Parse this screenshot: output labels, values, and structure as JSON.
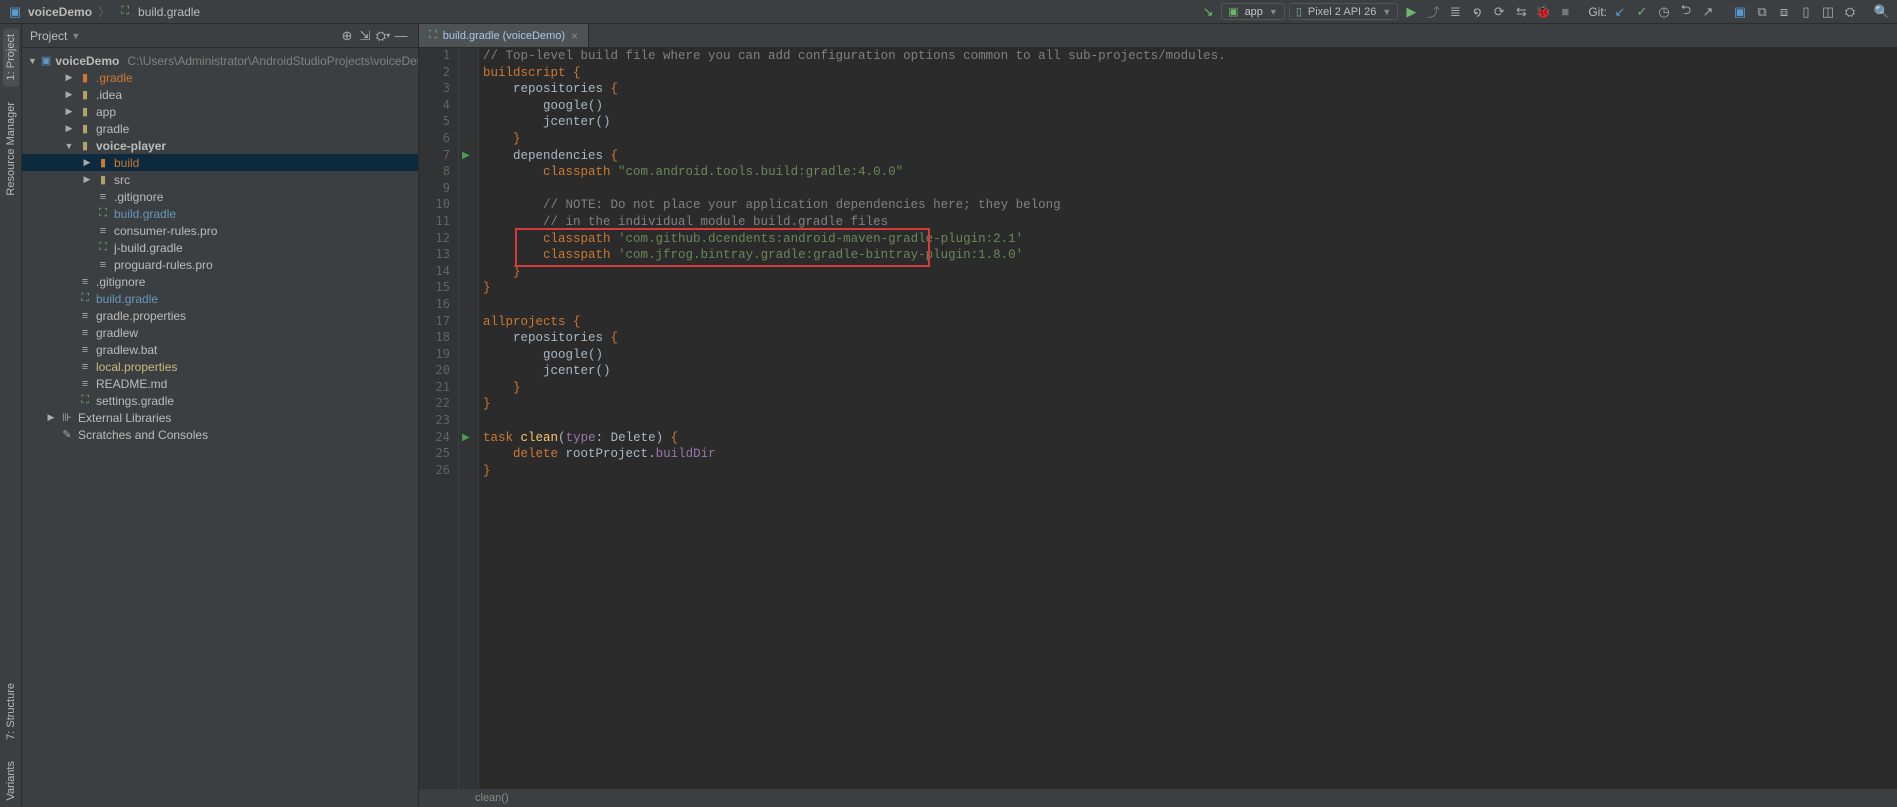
{
  "breadcrumb": {
    "project": "voiceDemo",
    "file_icon": "gradle-icon",
    "file": "build.gradle"
  },
  "toolbar": {
    "run_configs": [
      {
        "icon": "android-icon",
        "label": "app"
      },
      {
        "icon": "device-icon",
        "label": "Pixel 2 API 26"
      }
    ],
    "git_label": "Git:"
  },
  "project_panel": {
    "title": "Project",
    "root": {
      "name": "voiceDemo",
      "path": "C:\\Users\\Administrator\\AndroidStudioProjects\\voiceDemo"
    },
    "tree": [
      {
        "indent": 1,
        "arrow": "▶",
        "icon": "folder-orange",
        "label": ".gradle",
        "cls": "orange"
      },
      {
        "indent": 1,
        "arrow": "▶",
        "icon": "folder",
        "label": ".idea"
      },
      {
        "indent": 1,
        "arrow": "▶",
        "icon": "folder",
        "label": "app"
      },
      {
        "indent": 1,
        "arrow": "▶",
        "icon": "folder",
        "label": "gradle"
      },
      {
        "indent": 1,
        "arrow": "▼",
        "icon": "folder",
        "label": "voice-player",
        "bold": true
      },
      {
        "indent": 2,
        "arrow": "▶",
        "icon": "folder-orange",
        "label": "build",
        "cls": "orange",
        "sel": true
      },
      {
        "indent": 2,
        "arrow": "▶",
        "icon": "folder",
        "label": "src"
      },
      {
        "indent": 2,
        "arrow": "",
        "icon": "file",
        "label": ".gitignore"
      },
      {
        "indent": 2,
        "arrow": "",
        "icon": "gradle",
        "label": "build.gradle",
        "cls": "blue"
      },
      {
        "indent": 2,
        "arrow": "",
        "icon": "file",
        "label": "consumer-rules.pro"
      },
      {
        "indent": 2,
        "arrow": "",
        "icon": "gradle",
        "label": "j-build.gradle"
      },
      {
        "indent": 2,
        "arrow": "",
        "icon": "file",
        "label": "proguard-rules.pro"
      },
      {
        "indent": 1,
        "arrow": "",
        "icon": "file",
        "label": ".gitignore"
      },
      {
        "indent": 1,
        "arrow": "",
        "icon": "gradle",
        "label": "build.gradle",
        "cls": "blue"
      },
      {
        "indent": 1,
        "arrow": "",
        "icon": "file",
        "label": "gradle.properties"
      },
      {
        "indent": 1,
        "arrow": "",
        "icon": "file",
        "label": "gradlew"
      },
      {
        "indent": 1,
        "arrow": "",
        "icon": "file",
        "label": "gradlew.bat"
      },
      {
        "indent": 1,
        "arrow": "",
        "icon": "file",
        "label": "local.properties",
        "cls": "yellow"
      },
      {
        "indent": 1,
        "arrow": "",
        "icon": "file",
        "label": "README.md"
      },
      {
        "indent": 1,
        "arrow": "",
        "icon": "gradle",
        "label": "settings.gradle"
      },
      {
        "indent": 0,
        "arrow": "▶",
        "icon": "lib",
        "label": "External Libraries"
      },
      {
        "indent": 0,
        "arrow": "",
        "icon": "scratch",
        "label": "Scratches and Consoles"
      }
    ]
  },
  "editor": {
    "tab_label": "build.gradle (voiceDemo)",
    "status": "clean()",
    "highlight": {
      "startLine": 12,
      "endLine": 13
    },
    "lines": [
      {
        "n": 1,
        "html": "<span class='cm'>// Top-level build file where you can add configuration options common to all sub-projects/modules.</span>"
      },
      {
        "n": 2,
        "html": "<span class='kw'>buildscript</span> <span class='kw'>{</span>"
      },
      {
        "n": 3,
        "html": "    repositories <span class='kw'>{</span>"
      },
      {
        "n": 4,
        "html": "        google()"
      },
      {
        "n": 5,
        "html": "        jcenter()"
      },
      {
        "n": 6,
        "html": "    <span class='kw'>}</span>"
      },
      {
        "n": 7,
        "html": "    dependencies <span class='kw'>{</span>",
        "play": true
      },
      {
        "n": 8,
        "html": "        <span class='kw'>classpath</span> <span class='str'>\"com.android.tools.build:gradle:4.0.0\"</span>"
      },
      {
        "n": 9,
        "html": ""
      },
      {
        "n": 10,
        "html": "        <span class='cm'>// NOTE: Do not place your application dependencies here; they belong</span>"
      },
      {
        "n": 11,
        "html": "        <span class='cm'>// in the individual module build.gradle files</span>"
      },
      {
        "n": 12,
        "html": "        <span class='kw'>classpath</span> <span class='str'>'com.github.dcendents:android-maven-gradle-plugin:2.1'</span>"
      },
      {
        "n": 13,
        "html": "        <span class='kw'>classpath</span> <span class='str'>'com.jfrog.bintray.gradle:gradle-bintray-plugin:1.8.0'</span>"
      },
      {
        "n": 14,
        "html": "    <span class='kw'>}</span>"
      },
      {
        "n": 15,
        "html": "<span class='kw'>}</span>"
      },
      {
        "n": 16,
        "html": ""
      },
      {
        "n": 17,
        "html": "<span class='kw'>allprojects</span> <span class='kw'>{</span>"
      },
      {
        "n": 18,
        "html": "    repositories <span class='kw'>{</span>"
      },
      {
        "n": 19,
        "html": "        google()"
      },
      {
        "n": 20,
        "html": "        jcenter()"
      },
      {
        "n": 21,
        "html": "    <span class='kw'>}</span>"
      },
      {
        "n": 22,
        "html": "<span class='kw'>}</span>"
      },
      {
        "n": 23,
        "html": ""
      },
      {
        "n": 24,
        "html": "<span class='kw'>task</span> <span class='fn'>clean</span>(<span class='id'>type</span>: Delete) <span class='kw'>{</span>",
        "play": true
      },
      {
        "n": 25,
        "html": "    <span class='kw'>delete</span> rootProject.<span class='id'>buildDir</span>"
      },
      {
        "n": 26,
        "html": "<span class='kw'>}</span>"
      }
    ]
  },
  "side_tabs": {
    "project": "1: Project",
    "resmgr": "Resource Manager",
    "structure": "7: Structure",
    "variants": "Variants"
  }
}
